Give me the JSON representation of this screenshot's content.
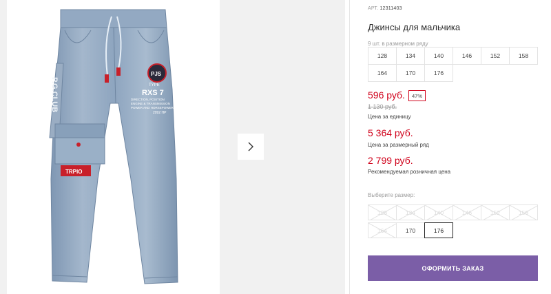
{
  "product": {
    "art_label": "АРТ.",
    "art_number": "12311403",
    "title": "Джинсы для мальчика"
  },
  "series": {
    "label": "9 шт. в размерном ряду",
    "sizes": [
      "128",
      "134",
      "140",
      "146",
      "152",
      "158",
      "164",
      "170",
      "176"
    ]
  },
  "prices": {
    "unit_price": "596 руб.",
    "discount": "47%",
    "old_price": "1 130 руб.",
    "unit_caption": "Цена за единицу",
    "series_price": "5 364 руб.",
    "series_caption": "Цена за размерный ряд",
    "retail_price": "2 799 руб.",
    "retail_caption": "Рекомендуемая розничная цена"
  },
  "size_select": {
    "label": "Выберите размер:",
    "options": [
      {
        "label": "128",
        "available": false,
        "selected": false
      },
      {
        "label": "134",
        "available": false,
        "selected": false
      },
      {
        "label": "140",
        "available": false,
        "selected": false
      },
      {
        "label": "146",
        "available": false,
        "selected": false
      },
      {
        "label": "152",
        "available": false,
        "selected": false
      },
      {
        "label": "158",
        "available": false,
        "selected": false
      },
      {
        "label": "164",
        "available": false,
        "selected": false
      },
      {
        "label": "170",
        "available": true,
        "selected": false
      },
      {
        "label": "176",
        "available": true,
        "selected": true
      }
    ]
  },
  "order_button": "ОФОРМИТЬ ЗАКАЗ",
  "gallery": {
    "next_icon": "chevron-right-icon",
    "patch_text_1": "RXS 7",
    "patch_text_2": "TYPE",
    "patch_text_3": "DIRECTION, POSITION",
    "patch_text_4": "ENGINE & TRANSMISSION",
    "patch_text_5": "POWER AND HORSEPOWER",
    "patch_text_6": "2092 HP",
    "badge_text": "PJS",
    "strap_text": "P.G.CLUB",
    "knee_patch_text": "TRPIO"
  },
  "colors": {
    "accent": "#7b5ea7",
    "price": "#d0021b",
    "denim": "#8da4be"
  }
}
